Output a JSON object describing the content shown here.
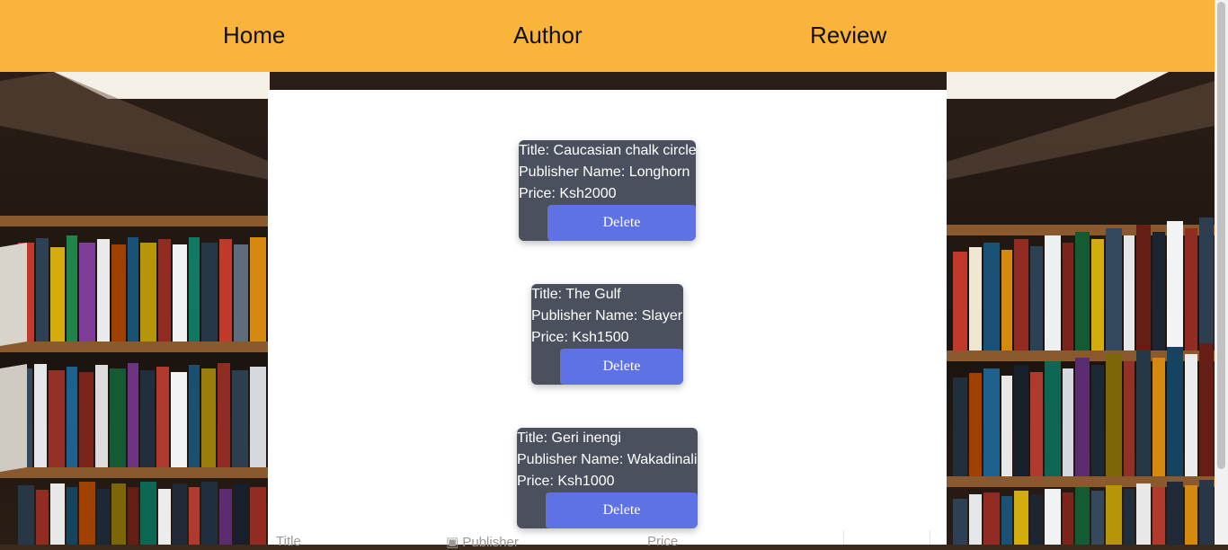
{
  "nav": {
    "home": "Home",
    "author": "Author",
    "review": "Review"
  },
  "books": [
    {
      "title_line": "Title: Caucasian chalk circle",
      "publisher_line": "Publisher Name: Longhorn",
      "price_line": "Price: Ksh2000",
      "delete_label": "Delete"
    },
    {
      "title_line": "Title: The Gulf",
      "publisher_line": "Publisher Name: Slayer",
      "price_line": "Price: Ksh1500",
      "delete_label": "Delete"
    },
    {
      "title_line": "Title: Geri inengi",
      "publisher_line": "Publisher Name: Wakadinali",
      "price_line": "Price: Ksh1000",
      "delete_label": "Delete"
    }
  ],
  "table": {
    "headers": [
      "Title",
      "Publisher",
      "Price"
    ]
  },
  "colors": {
    "navbar": "#fab43b",
    "card": "#4a505e",
    "delete_button": "#5e72e4"
  }
}
